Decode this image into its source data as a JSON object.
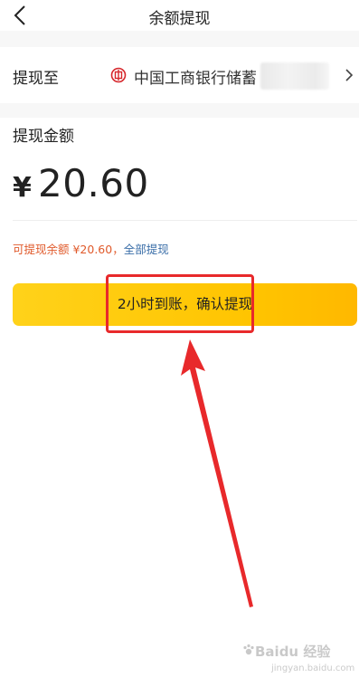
{
  "header": {
    "title": "余额提现"
  },
  "withdraw_to": {
    "label": "提现至",
    "bank_name": "中国工商银行储蓄"
  },
  "amount": {
    "label": "提现金额",
    "currency": "¥",
    "value": "20.60"
  },
  "balance": {
    "text": "可提现余额  ¥20.60，",
    "withdraw_all_label": "全部提现"
  },
  "confirm_button": {
    "label": "2小时到账，确认提现"
  },
  "colors": {
    "button_yellow": "#ffc700",
    "balance_orange": "#e05a2b",
    "link_blue": "#3a6ea8",
    "annotation_red": "#e8292b"
  },
  "watermark": {
    "brand": "Baidu 经验",
    "url": "jingyan.baidu.com"
  }
}
